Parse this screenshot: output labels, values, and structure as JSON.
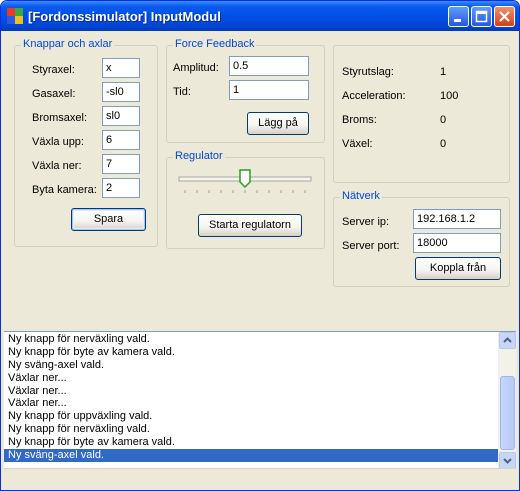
{
  "window": {
    "title": "[Fordonssimulator] InputModul"
  },
  "controls_group": {
    "legend": "Knappar och axlar",
    "rows": [
      {
        "label": "Styraxel:",
        "value": "x"
      },
      {
        "label": "Gasaxel:",
        "value": "-sl0"
      },
      {
        "label": "Bromsaxel:",
        "value": "sl0"
      },
      {
        "label": "Växla upp:",
        "value": "6"
      },
      {
        "label": "Växla ner:",
        "value": "7"
      },
      {
        "label": "Byta kamera:",
        "value": "2"
      }
    ],
    "save_button": "Spara"
  },
  "force_feedback": {
    "legend": "Force Feedback",
    "amplitude_label": "Amplitud:",
    "amplitude_value": "0.5",
    "time_label": "Tid:",
    "time_value": "1",
    "apply_button": "Lägg på"
  },
  "regulator": {
    "legend": "Regulator",
    "slider_value": 0.5,
    "start_button": "Starta regulatorn"
  },
  "status": {
    "rows": [
      {
        "label": "Styrutslag:",
        "value": "1"
      },
      {
        "label": "Acceleration:",
        "value": "100"
      },
      {
        "label": "Broms:",
        "value": "0"
      },
      {
        "label": "Växel:",
        "value": "0"
      }
    ]
  },
  "network": {
    "legend": "Nätverk",
    "ip_label": "Server ip:",
    "ip_value": "192.168.1.2",
    "port_label": "Server port:",
    "port_value": "18000",
    "disconnect_button": "Koppla från"
  },
  "log": {
    "lines": [
      "Ny knapp för nerväxling vald.",
      "Ny knapp för byte av kamera vald.",
      "Ny sväng-axel vald.",
      "Växlar ner...",
      "Växlar ner...",
      "Växlar ner...",
      "Ny knapp för uppväxling vald.",
      "Ny knapp för nerväxling vald.",
      "Ny knapp för byte av kamera vald.",
      "Ny sväng-axel vald."
    ],
    "selected_index": 9
  }
}
